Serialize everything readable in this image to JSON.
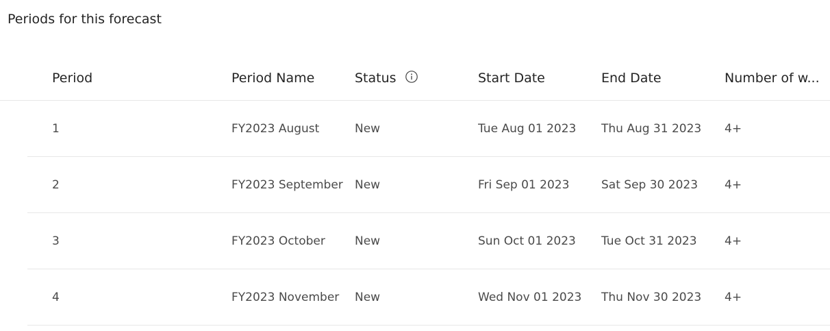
{
  "section": {
    "title": "Periods for this forecast"
  },
  "table": {
    "columns": {
      "period": "Period",
      "period_name": "Period Name",
      "status": "Status",
      "start_date": "Start Date",
      "end_date": "End Date",
      "weeks": "Number of w..."
    },
    "status_info_icon": "info-icon",
    "rows": [
      {
        "period": "1",
        "period_name": "FY2023 August",
        "status": "New",
        "start_date": "Tue Aug 01 2023",
        "end_date": "Thu Aug 31 2023",
        "weeks": "4+"
      },
      {
        "period": "2",
        "period_name": "FY2023 September",
        "status": "New",
        "start_date": "Fri Sep 01 2023",
        "end_date": "Sat Sep 30 2023",
        "weeks": "4+"
      },
      {
        "period": "3",
        "period_name": "FY2023 October",
        "status": "New",
        "start_date": "Sun Oct 01 2023",
        "end_date": "Tue Oct 31 2023",
        "weeks": "4+"
      },
      {
        "period": "4",
        "period_name": "FY2023 November",
        "status": "New",
        "start_date": "Wed Nov 01 2023",
        "end_date": "Thu Nov 30 2023",
        "weeks": "4+"
      }
    ]
  }
}
